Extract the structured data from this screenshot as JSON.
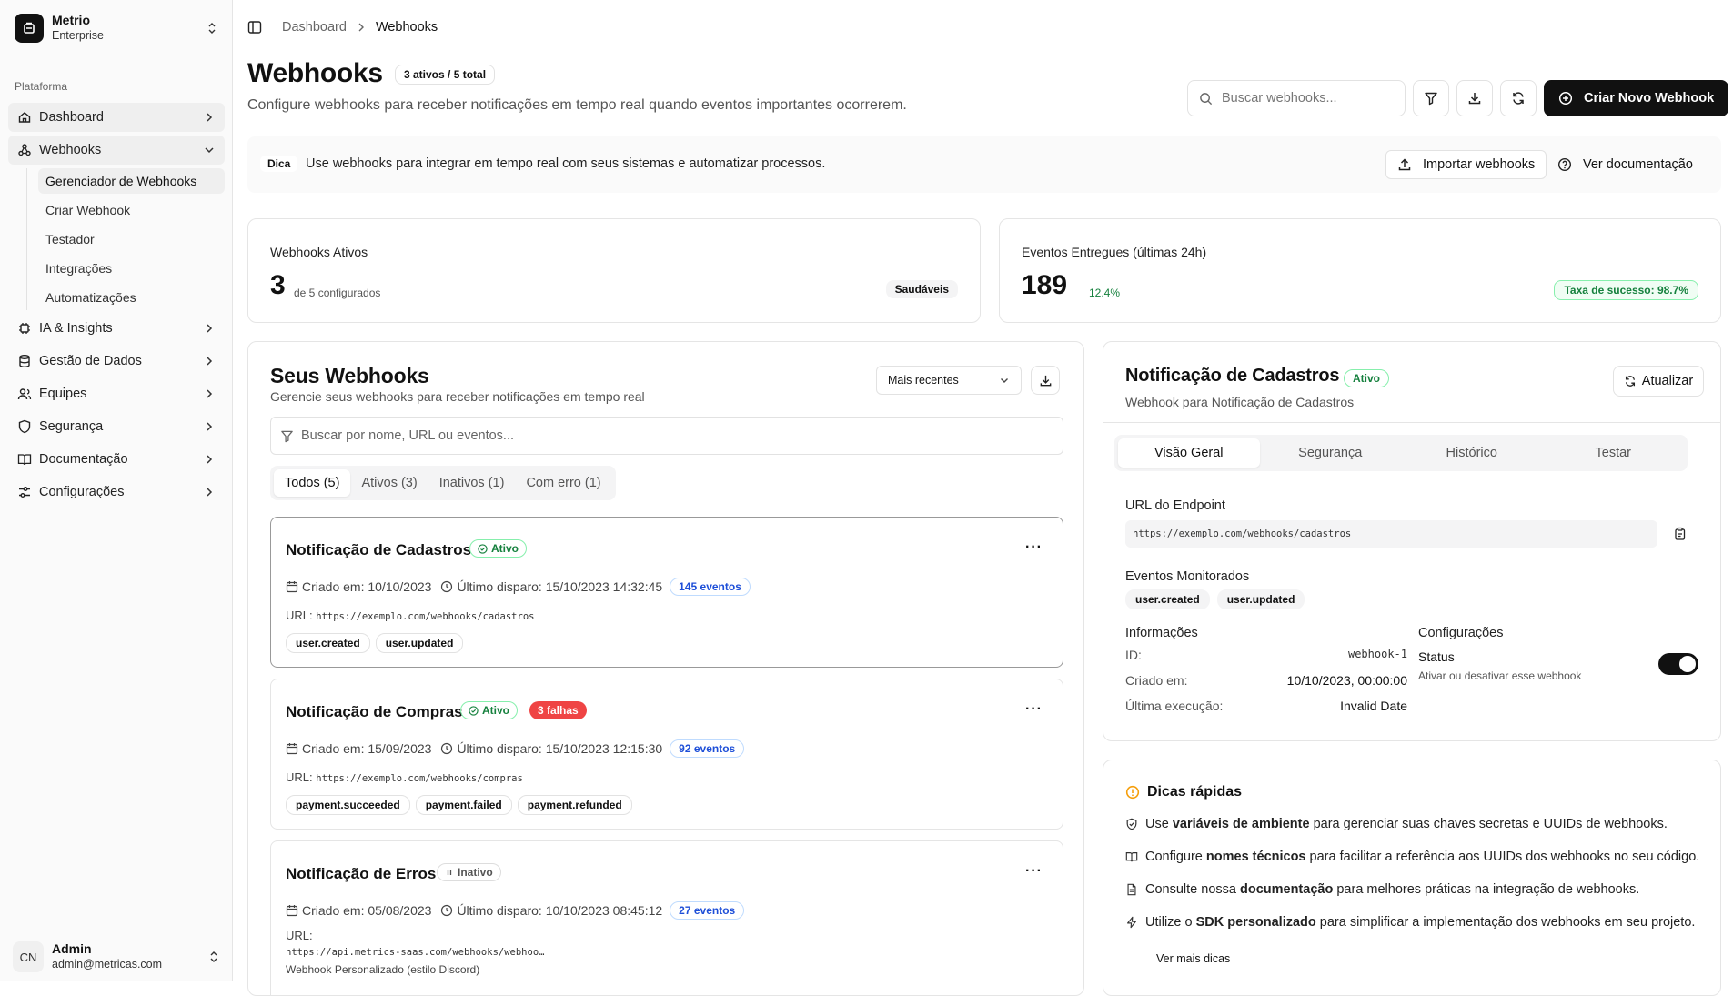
{
  "sidebar": {
    "brand": {
      "name": "Metrio",
      "plan": "Enterprise"
    },
    "group_label": "Plataforma",
    "items": [
      {
        "label": "Dashboard"
      },
      {
        "label": "Webhooks"
      },
      {
        "label": "IA & Insights"
      },
      {
        "label": "Gestão de Dados"
      },
      {
        "label": "Equipes"
      },
      {
        "label": "Segurança"
      },
      {
        "label": "Documentação"
      },
      {
        "label": "Configurações"
      }
    ],
    "sub_items": [
      "Gerenciador de Webhooks",
      "Criar Webhook",
      "Testador",
      "Integrações",
      "Automatizações"
    ],
    "user": {
      "initials": "CN",
      "name": "Admin",
      "email": "admin@metricas.com"
    }
  },
  "breadcrumb": {
    "parent": "Dashboard",
    "current": "Webhooks"
  },
  "header": {
    "title": "Webhooks",
    "count_badge": "3 ativos / 5 total",
    "subtitle": "Configure webhooks para receber notificações em tempo real quando eventos importantes ocorrerem.",
    "search_placeholder": "Buscar webhooks...",
    "create_label": "Criar Novo Webhook"
  },
  "tip": {
    "label": "Dica",
    "text": "Use webhooks para integrar em tempo real com seus sistemas e automatizar processos.",
    "import_label": "Importar webhooks",
    "docs_label": "Ver documentação"
  },
  "stats": {
    "active": {
      "title": "Webhooks Ativos",
      "value": "3",
      "note": "de 5 configurados",
      "badge": "Saudáveis"
    },
    "events": {
      "title": "Eventos Entregues (últimas 24h)",
      "value": "189",
      "note": "12.4%",
      "badge": "Taxa de sucesso: 98.7%"
    }
  },
  "list": {
    "title": "Seus Webhooks",
    "subtitle": "Gerencie seus webhooks para receber notificações em tempo real",
    "sort": "Mais recentes",
    "search_placeholder": "Buscar por nome, URL ou eventos...",
    "tabs": [
      "Todos (5)",
      "Ativos (3)",
      "Inativos (1)",
      "Com erro (1)"
    ],
    "created_prefix": "Criado em:",
    "last_prefix": "Último disparo:",
    "url_prefix": "URL:",
    "webhooks": [
      {
        "name": "Notificação de Cadastros",
        "status": "Ativo",
        "created": "10/10/2023",
        "last": "15/10/2023 14:32:45",
        "events": "145 eventos",
        "url": "https://exemplo.com/webhooks/cadastros",
        "tags": [
          "user.created",
          "user.updated"
        ]
      },
      {
        "name": "Notificação de Compras",
        "status": "Ativo",
        "fails": "3 falhas",
        "created": "15/09/2023",
        "last": "15/10/2023 12:15:30",
        "events": "92 eventos",
        "url": "https://exemplo.com/webhooks/compras",
        "tags": [
          "payment.succeeded",
          "payment.failed",
          "payment.refunded"
        ]
      },
      {
        "name": "Notificação de Erros",
        "status": "Inativo",
        "created": "05/08/2023",
        "last": "10/10/2023 08:45:12",
        "events": "27 eventos",
        "url": "https://api.metrics-saas.com/webhooks/webhoo…",
        "extra": "Webhook Personalizado (estilo Discord)"
      }
    ]
  },
  "detail": {
    "title": "Notificação de Cadastros",
    "status": "Ativo",
    "subtitle": "Webhook para Notificação de Cadastros",
    "refresh_label": "Atualizar",
    "tabs": [
      "Visão Geral",
      "Segurança",
      "Histórico",
      "Testar"
    ],
    "endpoint_label": "URL do Endpoint",
    "endpoint_url": "https://exemplo.com/webhooks/cadastros",
    "events_label": "Eventos Monitorados",
    "events": [
      "user.created",
      "user.updated"
    ],
    "info_label": "Informações",
    "info": [
      {
        "key": "ID:",
        "value": "webhook-1"
      },
      {
        "key": "Criado em:",
        "value": "10/10/2023, 00:00:00"
      },
      {
        "key": "Última execução:",
        "value": "Invalid Date"
      }
    ],
    "config_label": "Configurações",
    "status_label": "Status",
    "status_desc": "Ativar ou desativar esse webhook",
    "status_on": true
  },
  "quick_tips": {
    "title": "Dicas rápidas",
    "items": [
      {
        "pre": "Use ",
        "bold": "variáveis de ambiente",
        "post": " para gerenciar suas chaves secretas e UUIDs de webhooks."
      },
      {
        "pre": "Configure ",
        "bold": "nomes técnicos",
        "post": " para facilitar a referência aos UUIDs dos webhooks no seu código."
      },
      {
        "pre": "Consulte nossa ",
        "bold": "documentação",
        "post": " para melhores práticas na integração de webhooks."
      },
      {
        "pre": "Utilize o ",
        "bold": "SDK personalizado",
        "post": " para simplificar a implementação dos webhooks em seu projeto."
      }
    ],
    "more_label": "Ver mais dicas"
  },
  "colors": {
    "accent": "#111111",
    "success": "#15803d",
    "danger": "#ef4444",
    "info": "#1d4ed8",
    "warning": "#f59e0b"
  }
}
